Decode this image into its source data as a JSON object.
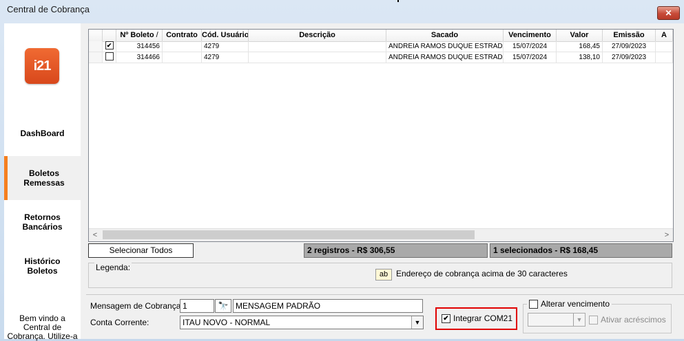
{
  "window": {
    "title": "Central de Cobrança",
    "close": "✕"
  },
  "sidebar": {
    "logo": "i21",
    "items": [
      {
        "label": "DashBoard"
      },
      {
        "label": "Boletos\nRemessas"
      },
      {
        "label": "Retornos\nBancários"
      },
      {
        "label": "Histórico\nBoletos"
      }
    ],
    "welcome": "Bem vindo a\nCentral de\nCobrança. Utilize-a"
  },
  "grid": {
    "columns": [
      "",
      "Nº Boleto",
      "Contrato",
      "Cód. Usuário",
      "Descrição",
      "Sacado",
      "Vencimento",
      "Valor",
      "Emissão",
      "A"
    ],
    "sort_indicator": "/",
    "rows": [
      {
        "checked": true,
        "boleto": "314456",
        "contrato": "",
        "cod_usuario": "4279",
        "descricao": "",
        "sacado": "ANDREIA RAMOS DUQUE ESTRADA E CU",
        "vencimento": "15/07/2024",
        "valor": "168,45",
        "emissao": "27/09/2023"
      },
      {
        "checked": false,
        "boleto": "314466",
        "contrato": "",
        "cod_usuario": "4279",
        "descricao": "",
        "sacado": "ANDREIA RAMOS DUQUE ESTRADA E CU",
        "vencimento": "15/07/2024",
        "valor": "138,10",
        "emissao": "27/09/2023"
      }
    ],
    "scroll_left": "<",
    "scroll_right": ">"
  },
  "actions": {
    "select_all": "Selecionar Todos",
    "total_summary": "2 registros - R$ 306,55",
    "selected_summary": "1 selecionados - R$ 168,45"
  },
  "legend": {
    "title": "Legenda:",
    "swatch": "ab",
    "text": "Endereço de cobrança acima de 30 caracteres"
  },
  "form": {
    "mensagem_label": "Mensagem de Cobrança:",
    "mensagem_code": "1",
    "mensagem_text": "MENSAGEM PADRÃO",
    "conta_label": "Conta Corrente:",
    "conta_value": "ITAU NOVO - NORMAL",
    "integrar_label": "Integrar COM21",
    "integrar_checked": true,
    "alterar_label": "Alterar vencimento",
    "alterar_checked": false,
    "ativar_label": "Ativar acréscimos",
    "ativar_checked": false,
    "binoculars": "🔭",
    "dropdown_arrow": "▼"
  }
}
